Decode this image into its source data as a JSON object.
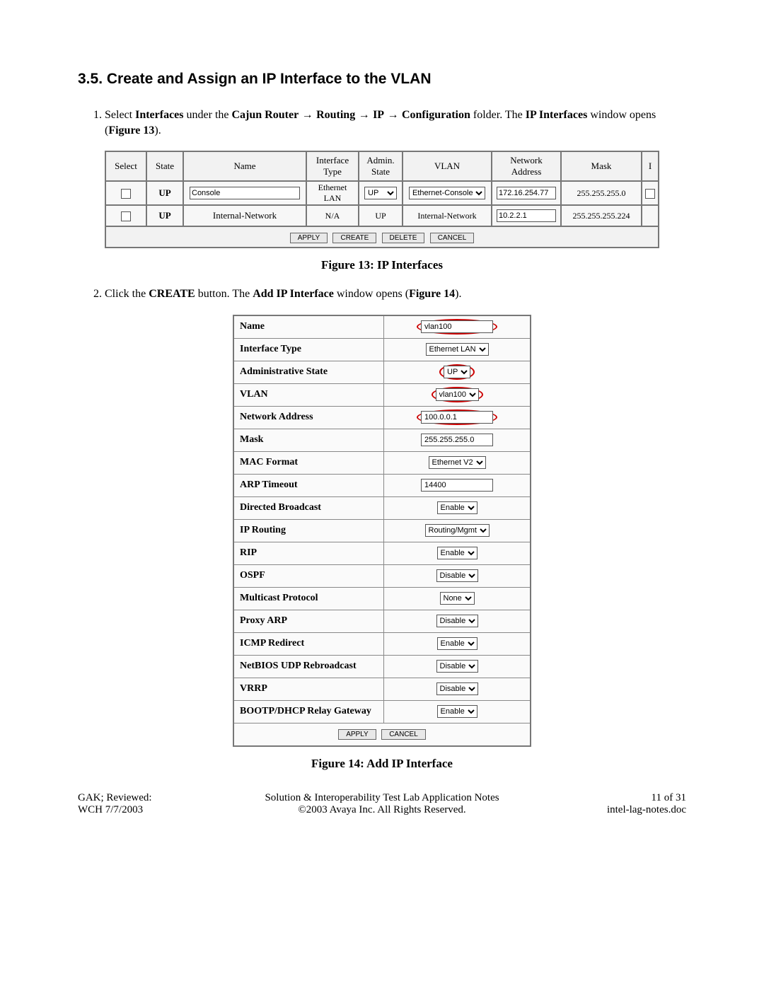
{
  "section": {
    "number": "3.5.",
    "title": "Create and Assign an IP Interface to the VLAN"
  },
  "step1": {
    "prefix": "Select ",
    "interfaces": "Interfaces",
    "mid1": " under the ",
    "cajun": "Cajun Router",
    "arrow": " → ",
    "routing": "Routing",
    "ip": "IP",
    "configuration": "Configuration",
    "suffix": " folder.  The ",
    "ip_interfaces": "IP Interfaces",
    "tail": " window opens (",
    "figref": "Figure 13",
    "close": ")."
  },
  "step2": {
    "prefix": "Click the ",
    "create": "CREATE",
    "mid": " button.  The ",
    "window": "Add IP Interface",
    "tail": " window opens (",
    "figref": "Figure 14",
    "close": ")."
  },
  "fig13": {
    "caption": "Figure 13: IP Interfaces",
    "headers": {
      "select": "Select",
      "state": "State",
      "name": "Name",
      "iftype": "Interface Type",
      "admin": "Admin. State",
      "vlan": "VLAN",
      "netaddr": "Network Address",
      "mask": "Mask",
      "edge": "I"
    },
    "rows": [
      {
        "state": "UP",
        "name": "Console",
        "iftype": "Ethernet LAN",
        "admin": "UP",
        "vlan": "Ethernet-Console",
        "netaddr": "172.16.254.77",
        "mask": "255.255.255.0"
      },
      {
        "state": "UP",
        "name": "Internal-Network",
        "iftype": "N/A",
        "admin": "UP",
        "vlan": "Internal-Network",
        "netaddr": "10.2.2.1",
        "mask": "255.255.255.224"
      }
    ],
    "buttons": {
      "apply": "APPLY",
      "create": "CREATE",
      "delete": "DELETE",
      "cancel": "CANCEL"
    }
  },
  "fig14": {
    "caption": "Figure 14: Add IP Interface",
    "fields": {
      "name": {
        "label": "Name",
        "value": "vlan100",
        "kind": "input",
        "circled": true
      },
      "iftype": {
        "label": "Interface Type",
        "value": "Ethernet LAN",
        "kind": "select",
        "circled": false
      },
      "admin": {
        "label": "Administrative State",
        "value": "UP",
        "kind": "select",
        "circled": true
      },
      "vlan": {
        "label": "VLAN",
        "value": "vlan100",
        "kind": "select",
        "circled": true
      },
      "netaddr": {
        "label": "Network Address",
        "value": "100.0.0.1",
        "kind": "input",
        "circled": true
      },
      "mask": {
        "label": "Mask",
        "value": "255.255.255.0",
        "kind": "input",
        "circled": false
      },
      "macformat": {
        "label": "MAC Format",
        "value": "Ethernet V2",
        "kind": "select",
        "circled": false
      },
      "arptimeout": {
        "label": "ARP Timeout",
        "value": "14400",
        "kind": "input",
        "circled": false
      },
      "dirbroadcast": {
        "label": "Directed Broadcast",
        "value": "Enable",
        "kind": "select",
        "circled": false
      },
      "iprouting": {
        "label": "IP Routing",
        "value": "Routing/Mgmt",
        "kind": "select",
        "circled": false
      },
      "rip": {
        "label": "RIP",
        "value": "Enable",
        "kind": "select",
        "circled": false
      },
      "ospf": {
        "label": "OSPF",
        "value": "Disable",
        "kind": "select",
        "circled": false
      },
      "multicast": {
        "label": "Multicast Protocol",
        "value": "None",
        "kind": "select",
        "circled": false
      },
      "proxyarp": {
        "label": "Proxy ARP",
        "value": "Disable",
        "kind": "select",
        "circled": false
      },
      "icmpredir": {
        "label": "ICMP Redirect",
        "value": "Enable",
        "kind": "select",
        "circled": false
      },
      "netbios": {
        "label": "NetBIOS UDP Rebroadcast",
        "value": "Disable",
        "kind": "select",
        "circled": false
      },
      "vrrp": {
        "label": "VRRP",
        "value": "Disable",
        "kind": "select",
        "circled": false
      },
      "bootp": {
        "label": "BOOTP/DHCP Relay Gateway",
        "value": "Enable",
        "kind": "select",
        "circled": false
      }
    },
    "field_order": [
      "name",
      "iftype",
      "admin",
      "vlan",
      "netaddr",
      "mask",
      "macformat",
      "arptimeout",
      "dirbroadcast",
      "iprouting",
      "rip",
      "ospf",
      "multicast",
      "proxyarp",
      "icmpredir",
      "netbios",
      "vrrp",
      "bootp"
    ],
    "buttons": {
      "apply": "APPLY",
      "cancel": "CANCEL"
    }
  },
  "footer": {
    "left1": "GAK; Reviewed:",
    "left2": "WCH 7/7/2003",
    "center1": "Solution & Interoperability Test Lab Application Notes",
    "center2": "©2003 Avaya Inc. All Rights Reserved.",
    "right1": "11 of 31",
    "right2": "intel-lag-notes.doc"
  }
}
